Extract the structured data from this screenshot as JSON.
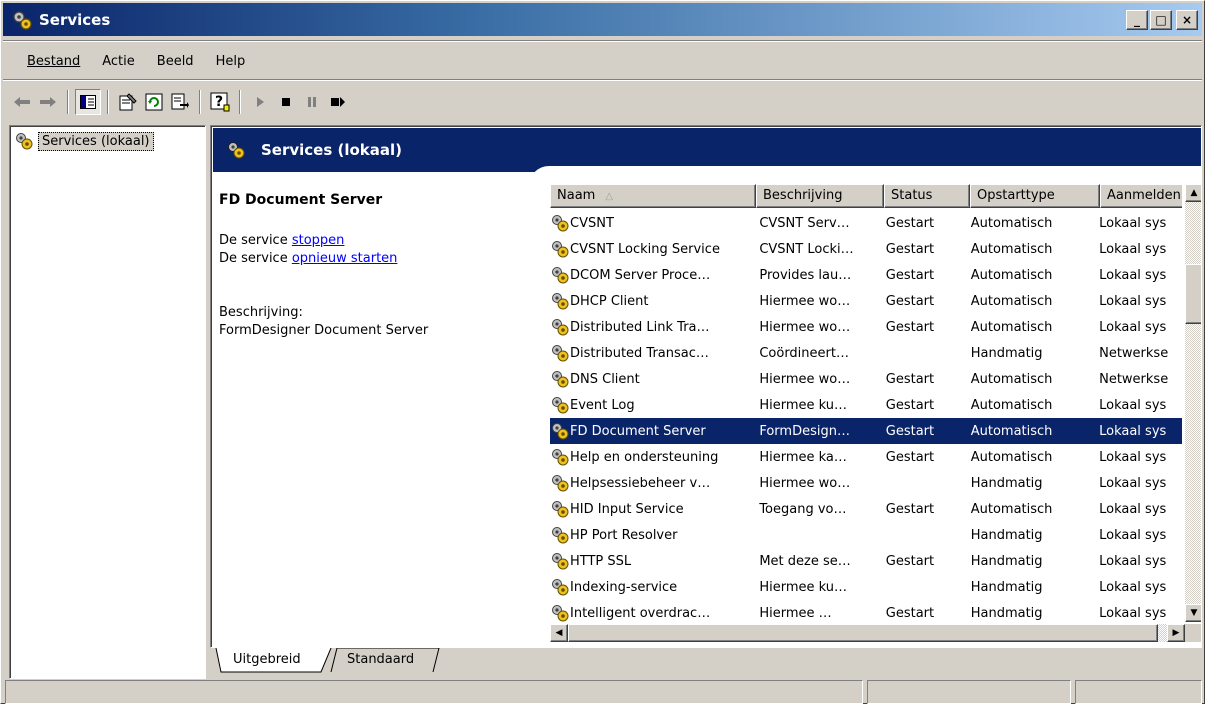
{
  "window": {
    "title": "Services",
    "caption_buttons": [
      "_",
      "□",
      "×"
    ]
  },
  "menu": {
    "items": [
      "Bestand",
      "Actie",
      "Beeld",
      "Help"
    ]
  },
  "toolbar": {
    "icons": [
      "back-icon",
      "forward-icon",
      "show-hide-tree-icon",
      "properties-icon",
      "refresh-icon",
      "export-list-icon",
      "help-icon",
      "start-icon",
      "stop-icon",
      "pause-icon",
      "restart-icon"
    ]
  },
  "tree": {
    "item_label": "Services (lokaal)"
  },
  "pane": {
    "header_title": "Services (lokaal)",
    "selected_service": "FD Document Server",
    "action_stop_prefix": "De service ",
    "action_stop_link": "stoppen",
    "action_restart_prefix": "De service ",
    "action_restart_link": "opnieuw starten",
    "description_label": "Beschrijving:",
    "description_text": "FormDesigner Document Server"
  },
  "list": {
    "columns": [
      "Naam",
      "Beschrijving",
      "Status",
      "Opstarttype",
      "Aanmelden"
    ],
    "sort_indicator": "△",
    "rows": [
      {
        "name": "CVSNT",
        "desc": "CVSNT Serv…",
        "status": "Gestart",
        "startup": "Automatisch",
        "logon": "Lokaal sys"
      },
      {
        "name": "CVSNT Locking Service",
        "desc": "CVSNT Locki…",
        "status": "Gestart",
        "startup": "Automatisch",
        "logon": "Lokaal sys"
      },
      {
        "name": "DCOM Server Proce…",
        "desc": "Provides lau…",
        "status": "Gestart",
        "startup": "Automatisch",
        "logon": "Lokaal sys"
      },
      {
        "name": "DHCP Client",
        "desc": "Hiermee wo…",
        "status": "Gestart",
        "startup": "Automatisch",
        "logon": "Lokaal sys"
      },
      {
        "name": "Distributed Link Tra…",
        "desc": "Hiermee wo…",
        "status": "Gestart",
        "startup": "Automatisch",
        "logon": "Lokaal sys"
      },
      {
        "name": "Distributed Transac…",
        "desc": "Coördineert…",
        "status": "",
        "startup": "Handmatig",
        "logon": "Netwerkse"
      },
      {
        "name": "DNS Client",
        "desc": "Hiermee wo…",
        "status": "Gestart",
        "startup": "Automatisch",
        "logon": "Netwerkse"
      },
      {
        "name": "Event Log",
        "desc": "Hiermee ku…",
        "status": "Gestart",
        "startup": "Automatisch",
        "logon": "Lokaal sys"
      },
      {
        "name": "FD Document Server",
        "desc": "FormDesign…",
        "status": "Gestart",
        "startup": "Automatisch",
        "logon": "Lokaal sys",
        "selected": true
      },
      {
        "name": "Help en ondersteuning",
        "desc": "Hiermee ka…",
        "status": "Gestart",
        "startup": "Automatisch",
        "logon": "Lokaal sys"
      },
      {
        "name": "Helpsessiebeheer v…",
        "desc": "Hiermee wo…",
        "status": "",
        "startup": "Handmatig",
        "logon": "Lokaal sys"
      },
      {
        "name": "HID Input Service",
        "desc": "Toegang vo…",
        "status": "Gestart",
        "startup": "Automatisch",
        "logon": "Lokaal sys"
      },
      {
        "name": "HP Port Resolver",
        "desc": "",
        "status": "",
        "startup": "Handmatig",
        "logon": "Lokaal sys"
      },
      {
        "name": "HTTP SSL",
        "desc": "Met deze se…",
        "status": "Gestart",
        "startup": "Handmatig",
        "logon": "Lokaal sys"
      },
      {
        "name": "Indexing-service",
        "desc": "Hiermee ku…",
        "status": "",
        "startup": "Handmatig",
        "logon": "Lokaal sys"
      },
      {
        "name": "Intelligent overdrac…",
        "desc": "Hiermee …",
        "status": "Gestart",
        "startup": "Handmatig",
        "logon": "Lokaal sys"
      }
    ]
  },
  "tabs": {
    "extended": "Uitgebreid",
    "standard": "Standaard"
  }
}
